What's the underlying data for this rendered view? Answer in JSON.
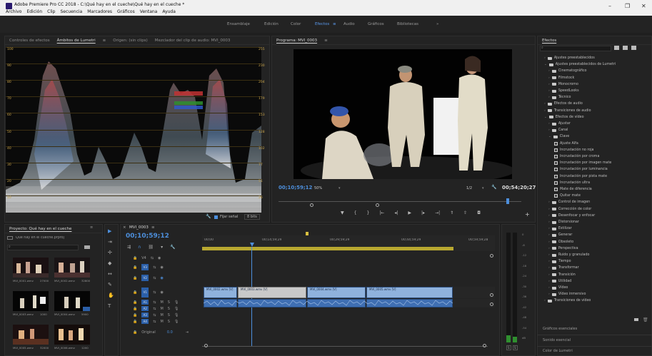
{
  "titlebar": {
    "title": "Adobe Premiere Pro CC 2018 - C:\\Qué hay en el cueche\\Qué hay en el cueche *",
    "menu": [
      "Archivo",
      "Edición",
      "Clip",
      "Secuencia",
      "Marcadores",
      "Gráficos",
      "Ventana",
      "Ayuda"
    ],
    "min": "–",
    "max": "❐",
    "close": "✕"
  },
  "workspaces": {
    "tabs": [
      "Ensamblaje",
      "Edición",
      "Color",
      "Efectos",
      "Audio",
      "Gráficos",
      "Bibliotecas"
    ],
    "active_index": 3,
    "more": "»"
  },
  "scope_panel": {
    "tabs": [
      "Controles de efectos",
      "Ámbitos de Lumetri",
      "Origen: (sin clips)",
      "Mezclador del clip de audio: MVI_0003"
    ],
    "active_index": 1,
    "menu_icon": "≡",
    "left_ticks": [
      "100",
      "90",
      "80",
      "70",
      "60",
      "50",
      "40",
      "30",
      "20",
      "10"
    ],
    "right_ticks": [
      "255",
      "230",
      "204",
      "179",
      "153",
      "128",
      "102",
      "77",
      "51",
      "26"
    ],
    "clamp_label": "Fijar señal",
    "bits": "8 bits"
  },
  "program": {
    "title": "Programa: MVI_0003",
    "menu_icon": "≡",
    "timecode": "00;10;59;12",
    "zoom": "50%",
    "quality": "1/2",
    "duration": "00;54;20;27"
  },
  "effects": {
    "title": "Efectos",
    "menu_icon": "≡",
    "items": [
      {
        "label": "Ajustes preestablecidos",
        "level": 0,
        "kind": "folder",
        "open": false
      },
      {
        "label": "Ajustes preestablecidos de Lumetri",
        "level": 0,
        "kind": "folder",
        "open": true
      },
      {
        "label": "Cinematográfico",
        "level": 1,
        "kind": "folder",
        "open": false
      },
      {
        "label": "Filmstock",
        "level": 1,
        "kind": "folder",
        "open": false
      },
      {
        "label": "Monocromo",
        "level": 1,
        "kind": "folder",
        "open": false
      },
      {
        "label": "SpeedLooks",
        "level": 1,
        "kind": "folder",
        "open": false
      },
      {
        "label": "Técnico",
        "level": 1,
        "kind": "folder",
        "open": false
      },
      {
        "label": "Efectos de audio",
        "level": 0,
        "kind": "folder",
        "open": false
      },
      {
        "label": "Transiciones de audio",
        "level": 0,
        "kind": "folder",
        "open": false
      },
      {
        "label": "Efectos de vídeo",
        "level": 0,
        "kind": "folder",
        "open": true
      },
      {
        "label": "Ajustar",
        "level": 1,
        "kind": "folder",
        "open": false
      },
      {
        "label": "Canal",
        "level": 1,
        "kind": "folder",
        "open": false
      },
      {
        "label": "Clave",
        "level": 1,
        "kind": "folder",
        "open": true
      },
      {
        "label": "Ajuste Alfa",
        "level": 2,
        "kind": "fx"
      },
      {
        "label": "Incrustación no roja",
        "level": 2,
        "kind": "fx"
      },
      {
        "label": "Incrustación por croma",
        "level": 2,
        "kind": "fx"
      },
      {
        "label": "Incrustación por imagen mate",
        "level": 2,
        "kind": "fx"
      },
      {
        "label": "Incrustación por luminancia",
        "level": 2,
        "kind": "fx"
      },
      {
        "label": "Incrustación por pista mate",
        "level": 2,
        "kind": "fx"
      },
      {
        "label": "Incrustación ultra",
        "level": 2,
        "kind": "fx"
      },
      {
        "label": "Mate de diferencia",
        "level": 2,
        "kind": "fx"
      },
      {
        "label": "Quitar mate",
        "level": 2,
        "kind": "fx"
      },
      {
        "label": "Control de imagen",
        "level": 1,
        "kind": "folder",
        "open": false
      },
      {
        "label": "Corrección de color",
        "level": 1,
        "kind": "folder",
        "open": false
      },
      {
        "label": "Desenfocar y enfocar",
        "level": 1,
        "kind": "folder",
        "open": false
      },
      {
        "label": "Distorsionar",
        "level": 1,
        "kind": "folder",
        "open": false
      },
      {
        "label": "Estilizar",
        "level": 1,
        "kind": "folder",
        "open": false
      },
      {
        "label": "Generar",
        "level": 1,
        "kind": "folder",
        "open": false
      },
      {
        "label": "Obsoleto",
        "level": 1,
        "kind": "folder",
        "open": false
      },
      {
        "label": "Perspectiva",
        "level": 1,
        "kind": "folder",
        "open": false
      },
      {
        "label": "Ruido y granulado",
        "level": 1,
        "kind": "folder",
        "open": false
      },
      {
        "label": "Tiempo",
        "level": 1,
        "kind": "folder",
        "open": false
      },
      {
        "label": "Transformar",
        "level": 1,
        "kind": "folder",
        "open": false
      },
      {
        "label": "Transición",
        "level": 1,
        "kind": "folder",
        "open": false
      },
      {
        "label": "Utilidad",
        "level": 1,
        "kind": "folder",
        "open": false
      },
      {
        "label": "Vídeo",
        "level": 1,
        "kind": "folder",
        "open": false
      },
      {
        "label": "Vídeo inmersivo",
        "level": 1,
        "kind": "folder",
        "open": false
      },
      {
        "label": "Transiciones de vídeo",
        "level": 0,
        "kind": "folder",
        "open": false
      }
    ],
    "footer": [
      "Gráficos esenciales",
      "Sonido esencial",
      "Color de Lumetri"
    ]
  },
  "project": {
    "title": "Proyecto: Qué hay en el cueche",
    "menu_icon": "≡",
    "file": "Qué hay en el cueche.prproj",
    "thumbs": [
      {
        "name": "MVI_0001.wmv",
        "dur": "27000"
      },
      {
        "name": "MVI_0002.wmv",
        "dur": "32800"
      },
      {
        "name": "MVI_0003.wmv",
        "dur": "1000"
      },
      {
        "name": "MVI_0004.wmv",
        "dur": "5900"
      },
      {
        "name": "MVI_0005.wmv",
        "dur": "32000"
      },
      {
        "name": "MVI_0006.wmv",
        "dur": "1200"
      }
    ]
  },
  "timeline": {
    "seq_name": "MVI_0003",
    "menu_icon": "≡",
    "timecode": "00;10;59;12",
    "ruler": [
      "00;00",
      "00;14;59;29",
      "00;29;59;29",
      "00;44;59;29",
      "00;59;59;28"
    ],
    "video_tracks": [
      "V4",
      "V3",
      "V2",
      "V1"
    ],
    "audio_tracks": [
      "A1",
      "A2",
      "A3",
      "A4"
    ],
    "track_m": "M",
    "track_s": "S",
    "master_label": "Original",
    "master_value": "0.0",
    "clips": [
      "MVI_0002.wmv [V]",
      "MVI_0003.wmv [V]",
      "MVI_0004.wmv [V]",
      "MVI_0005.wmv [V]"
    ],
    "db_ticks": [
      "0",
      "-6",
      "-12",
      "-18",
      "-24",
      "-30",
      "-36",
      "-42",
      "-48",
      "-54",
      "dB"
    ],
    "meter_s": "S",
    "meter_s2": "S"
  }
}
